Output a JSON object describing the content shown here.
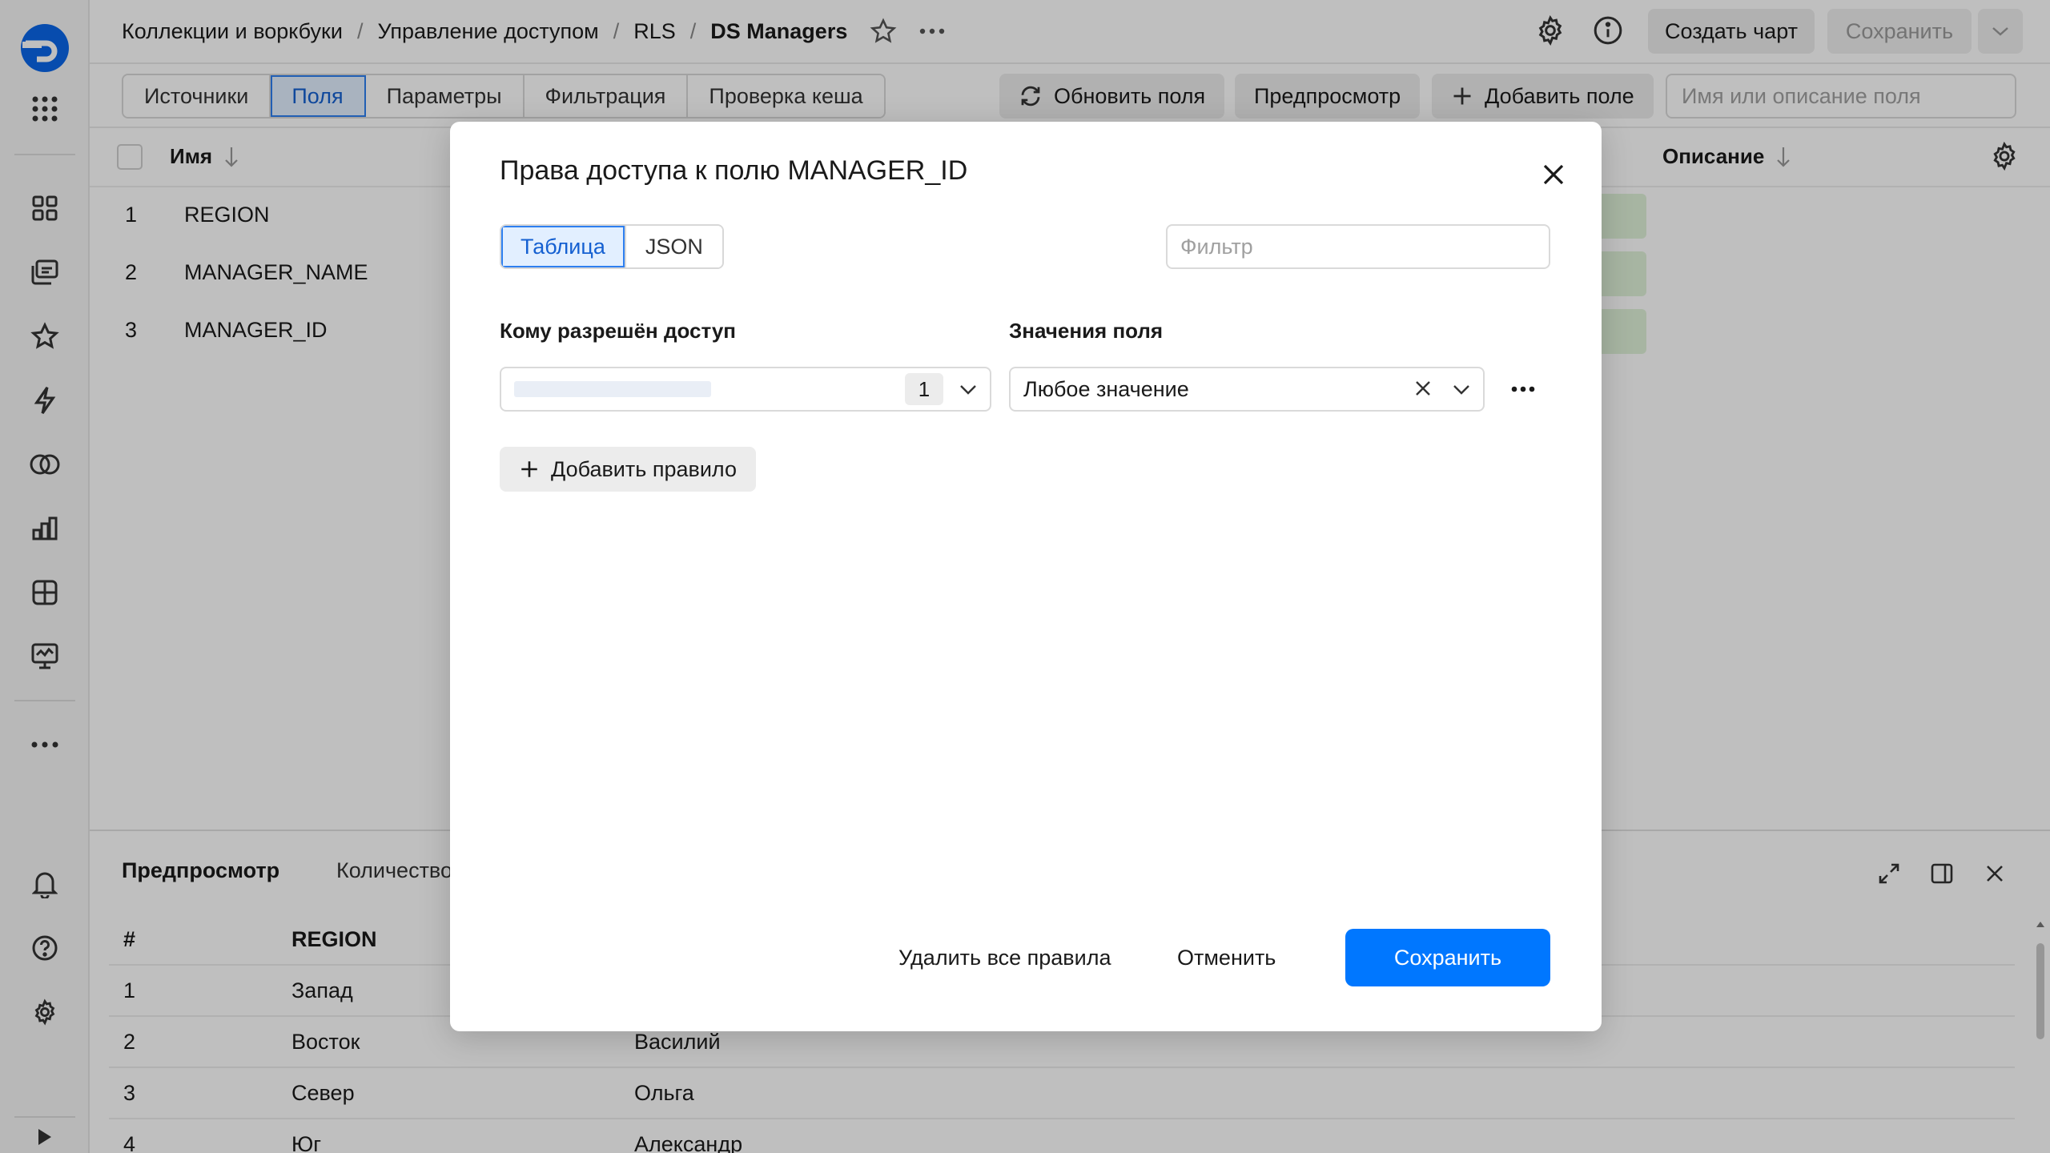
{
  "breadcrumbs": {
    "items": [
      "Коллекции и воркбуки",
      "Управление доступом",
      "RLS"
    ],
    "current": "DS Managers",
    "separator": "/"
  },
  "header": {
    "create_chart_label": "Создать чарт",
    "save_label": "Сохранить"
  },
  "toolbar": {
    "tabs": [
      {
        "label": "Источники",
        "active": false
      },
      {
        "label": "Поля",
        "active": true
      },
      {
        "label": "Параметры",
        "active": false
      },
      {
        "label": "Фильтрация",
        "active": false
      },
      {
        "label": "Проверка кеша",
        "active": false
      }
    ],
    "refresh_label": "Обновить поля",
    "preview_label": "Предпросмотр",
    "add_field_label": "Добавить поле",
    "search_placeholder": "Имя или описание поля"
  },
  "fields_table": {
    "col_name": "Имя",
    "col_description": "Описание",
    "rows": [
      {
        "index": "1",
        "name": "REGION"
      },
      {
        "index": "2",
        "name": "MANAGER_NAME"
      },
      {
        "index": "3",
        "name": "MANAGER_ID"
      }
    ]
  },
  "preview_panel": {
    "title": "Предпросмотр",
    "count_tab": "Количество",
    "headers": [
      "#",
      "REGION"
    ],
    "rows": [
      {
        "n": "1",
        "region": "Запад",
        "name": ""
      },
      {
        "n": "2",
        "region": "Восток",
        "name": "Василий"
      },
      {
        "n": "3",
        "region": "Север",
        "name": "Ольга"
      },
      {
        "n": "4",
        "region": "Юг",
        "name": "Александр"
      }
    ]
  },
  "modal": {
    "title": "Права доступа к полю MANAGER_ID",
    "view_tabs": [
      {
        "label": "Таблица",
        "active": true
      },
      {
        "label": "JSON",
        "active": false
      }
    ],
    "filter_placeholder": "Фильтр",
    "who_label": "Кому разрешён доступ",
    "values_label": "Значения поля",
    "rule": {
      "subjects_count": "1",
      "value": "Любое значение"
    },
    "add_rule_label": "Добавить правило",
    "delete_all_label": "Удалить все правила",
    "cancel_label": "Отменить",
    "save_label": "Сохранить"
  },
  "colors": {
    "accent": "#0077ff",
    "active_tab_bg": "#e2efff",
    "active_tab_text": "#1560d1",
    "overlay": "rgba(0,0,0,0.25)"
  }
}
